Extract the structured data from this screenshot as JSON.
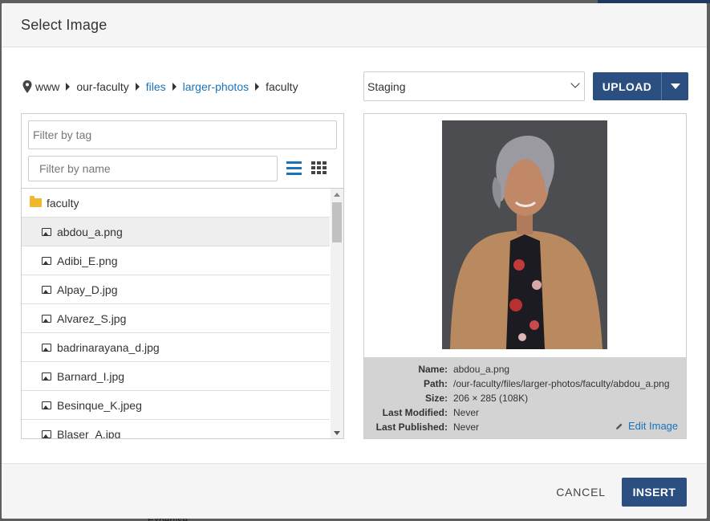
{
  "background": {
    "partial_text": "Expertise"
  },
  "dialog": {
    "title": "Select Image"
  },
  "breadcrumb": {
    "items": [
      {
        "label": "www",
        "link": false
      },
      {
        "label": "our-faculty",
        "link": false
      },
      {
        "label": "files",
        "link": true
      },
      {
        "label": "larger-photos",
        "link": true
      },
      {
        "label": "faculty",
        "link": false
      }
    ]
  },
  "environment": {
    "selected": "Staging"
  },
  "upload": {
    "label": "UPLOAD"
  },
  "filters": {
    "tag_placeholder": "Filter by tag",
    "name_placeholder": "Filter by name"
  },
  "file_list": {
    "folder": "faculty",
    "files": [
      "abdou_a.png",
      "Adibi_E.png",
      "Alpay_D.jpg",
      "Alvarez_S.jpg",
      "badrinarayana_d.jpg",
      "Barnard_I.jpg",
      "Besinque_K.jpeg",
      "Blaser_A.jpg"
    ],
    "selected_index": 0
  },
  "details": {
    "labels": {
      "name": "Name:",
      "path": "Path:",
      "size": "Size:",
      "modified": "Last Modified:",
      "published": "Last Published:"
    },
    "name": "abdou_a.png",
    "path": "/our-faculty/files/larger-photos/faculty/abdou_a.png",
    "size": "206 × 285 (108K)",
    "modified": "Never",
    "published": "Never",
    "edit_label": "Edit Image"
  },
  "footer": {
    "cancel_label": "CANCEL",
    "insert_label": "INSERT"
  },
  "colors": {
    "primary": "#2a4f80",
    "link": "#1a73b8",
    "folder": "#f0b82b"
  }
}
